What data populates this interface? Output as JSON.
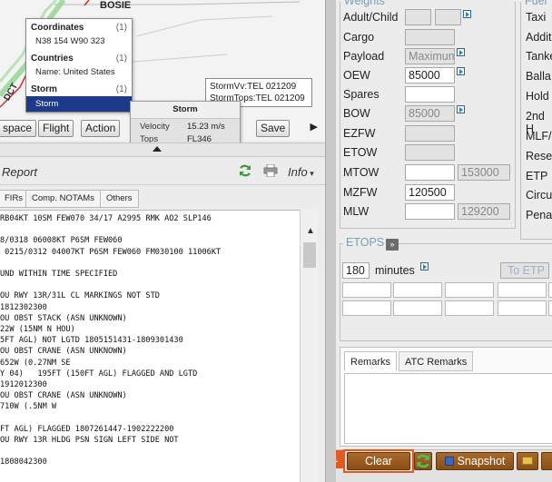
{
  "map": {
    "label_bosie": "BOSIE",
    "label_dct": "DCT",
    "popup": {
      "coordinates_header": "Coordinates",
      "coordinates_count": "(1)",
      "coordinates_value": "N38 154 W90 323",
      "countries_header": "Countries",
      "countries_count": "(1)",
      "countries_value": "Name: United States",
      "storm_header": "Storm",
      "storm_count": "(1)",
      "storm_value": "Storm"
    },
    "storm_detail": {
      "title": "Storm",
      "velocity_label": "Velocity",
      "velocity_value": "15.23 m/s",
      "tops_label": "Tops",
      "tops_value": "FL346"
    },
    "storm_tip_line1": "StormVv:TEL 021209",
    "storm_tip_line2": "StormTops:TEL 021209",
    "buttons": {
      "airspace": "space",
      "flight": "Flight",
      "action": "Action",
      "save": "Save"
    }
  },
  "report": {
    "title": "Report",
    "info_label": "Info",
    "tabs": [
      "FIRs",
      "Comp. NOTAMs",
      "Others"
    ],
    "lines": [
      "RB04KT 10SM FEW070 34/17 A2995 RMK AO2 SLP146",
      "",
      "8/0318 06008KT P6SM FEW060",
      " 0215/0312 04007KT P6SM FEW060 FM030100 11006KT",
      "",
      "UND WITHIN TIME SPECIFIED",
      "",
      "OU RWY 13R/31L CL MARKINGS NOT STD",
      "1812302300",
      "OU OBST STACK (ASN UNKNOWN)",
      "22W (15NM N HOU)",
      "5FT AGL) NOT LGTD 1805151431-1809301430",
      "OU OBST CRANE (ASN UNKNOWN)",
      "652W (0.27NM SE",
      "Y 04)   195FT (150FT AGL) FLAGGED AND LGTD",
      "1912012300",
      "OU OBST CRANE (ASN UNKNOWN)",
      "710W (.5NM W",
      "",
      "FT AGL) FLAGGED 1807261447-1902222200",
      "OU RWY 13R HLDG PSN SIGN LEFT SIDE NOT",
      "",
      "1808042300"
    ]
  },
  "weights": {
    "legend": "Weights",
    "adult_child": "Adult/Child",
    "cargo": "Cargo",
    "payload": "Payload",
    "payload_value": "Maximum",
    "oew": "OEW",
    "oew_value": "85000",
    "spares": "Spares",
    "bow": "BOW",
    "bow_value": "85000",
    "ezfw": "EZFW",
    "etow": "ETOW",
    "mtow": "MTOW",
    "mtow_value": "153000",
    "mzfw": "MZFW",
    "mzfw_value": "120500",
    "mlw": "MLW",
    "mlw_value": "129200"
  },
  "fuel": {
    "legend": "Fuel",
    "items": [
      "Taxi",
      "Additi",
      "Tanke",
      "Balla",
      "Hold",
      "2nd H",
      "MLF/",
      "Rese",
      "ETP",
      "Circu",
      "Pena"
    ]
  },
  "etops": {
    "legend": "ETOPS",
    "toggle": "»",
    "minutes_value": "180",
    "minutes_label": "minutes",
    "to_etp": "To ETP"
  },
  "remarks": {
    "tabs": [
      "Remarks",
      "ATC Remarks"
    ]
  },
  "bottom": {
    "step": "1",
    "clear": "Clear",
    "snapshot": "Snapshot"
  },
  "colors": {
    "accent_orange": "#e55a1c",
    "selected_blue": "#1d3a8a",
    "button_brown": "#9a5c20"
  }
}
